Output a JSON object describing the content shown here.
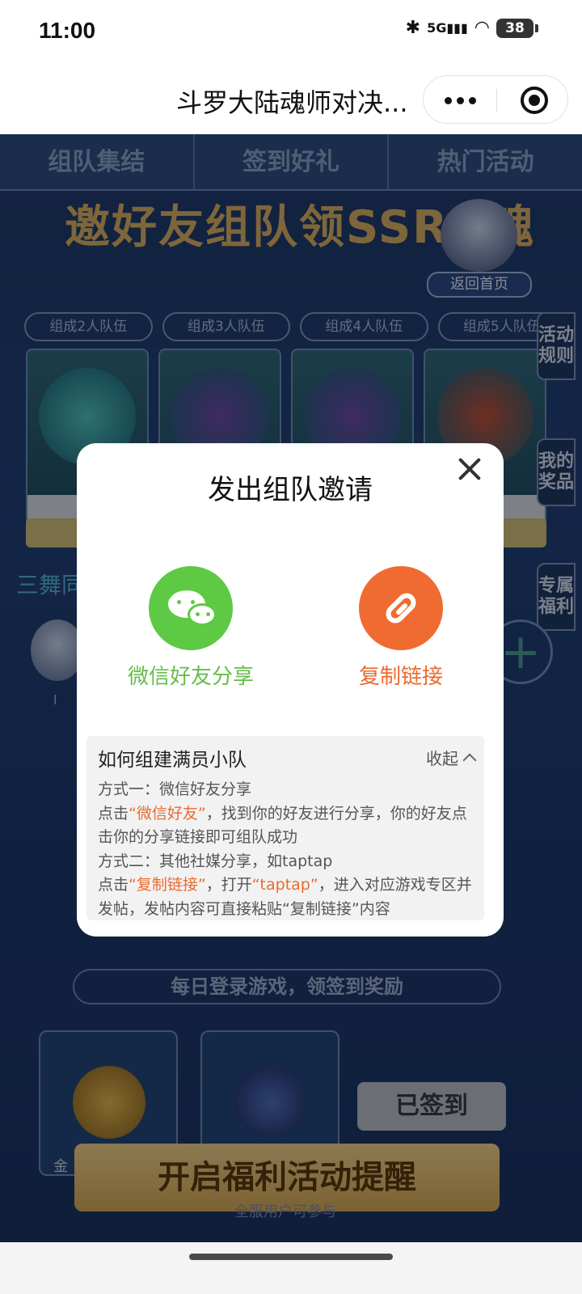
{
  "status_bar": {
    "time": "11:00",
    "network": "5G",
    "battery": "38"
  },
  "header": {
    "title": "斗罗大陆魂师对决..."
  },
  "background": {
    "tabs": [
      "组队集结",
      "签到好礼",
      "热门活动"
    ],
    "banner": "邀好友组队领SSR+魂",
    "back_home": "返回首页",
    "team_labels": [
      "组成2人队伍",
      "组成3人队伍",
      "组成4人队伍",
      "组成5人队伍"
    ],
    "side_tabs": [
      "活动规则",
      "我的奖品",
      "专属福利"
    ],
    "member_title": "三舞同",
    "member_name": "l",
    "sign_bar": "每日登录游戏，领签到奖励",
    "coin_label": "金",
    "signed_label": "已签到",
    "remind_label": "开启福利活动提醒",
    "all_users": "全服用户可参与"
  },
  "modal": {
    "title": "发出组队邀请",
    "options": [
      {
        "label": "微信好友分享",
        "icon": "wechat-icon",
        "color": "#5dc944"
      },
      {
        "label": "复制链接",
        "icon": "link-icon",
        "color": "#ef6b31"
      }
    ],
    "howto": {
      "title": "如何组建满员小队",
      "toggle": "收起",
      "line1": "方式一：微信好友分享",
      "line2_pre": "点击",
      "line2_hl": "“微信好友”",
      "line2_post": "，找到你的好友进行分享，你的好友点击你的分享链接即可组队成功",
      "line3": "方式二：其他社媒分享，如taptap",
      "line4_pre": "点击",
      "line4_hl1": "“复制链接”",
      "line4_mid": "，打开",
      "line4_hl2": "“taptap”",
      "line4_post": "，进入对应游戏专区并发帖，发帖内容可直接粘贴“复制链接”内容"
    }
  }
}
